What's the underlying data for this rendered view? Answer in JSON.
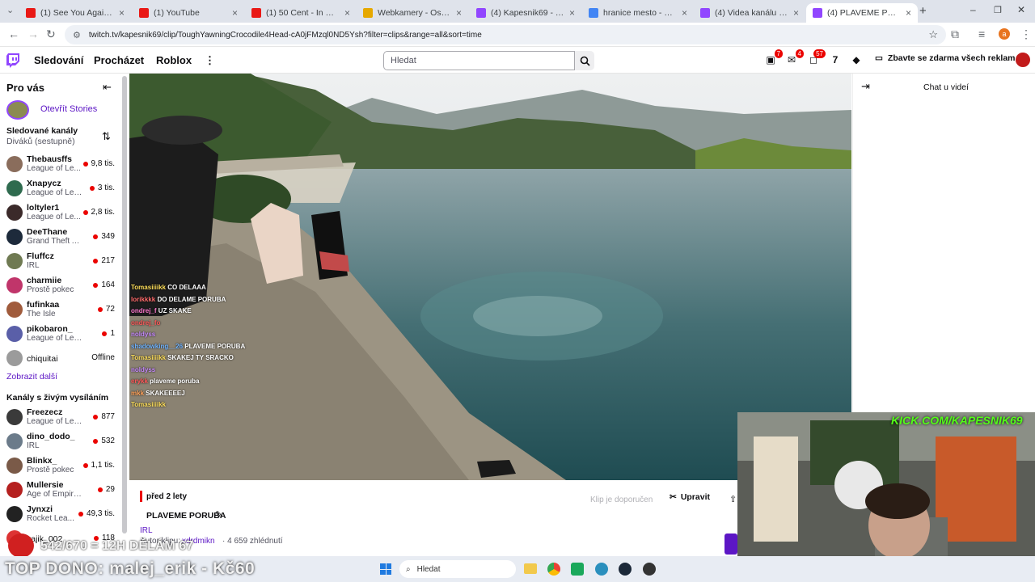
{
  "browser": {
    "tabs": [
      {
        "title": "(1) See You Again (Clean)",
        "color": "#e91916"
      },
      {
        "title": "(1) YouTube",
        "color": "#e91916"
      },
      {
        "title": "(1) 50 Cent - In Da Club (C",
        "color": "#e91916"
      },
      {
        "title": "Webkamery - Ostrava - V",
        "color": "#e6a800"
      },
      {
        "title": "(4) Kapesnik69 - Twitch",
        "color": "#9146ff"
      },
      {
        "title": "hranice mesto - Hledat G",
        "color": "#4285f4"
      },
      {
        "title": "(4) Videa kanálu Kapesni",
        "color": "#9146ff"
      },
      {
        "title": "(4) PLAVEME PORUBA",
        "color": "#9146ff"
      }
    ],
    "url": "twitch.tv/kapesnik69/clip/ToughYawningCrocodile4Head-cA0jFMzql0ND5Ysh?filter=clips&range=all&sort=time",
    "profile_letter": "a"
  },
  "header": {
    "nav": [
      "Sledování",
      "Procházet",
      "Roblox"
    ],
    "more": "⋮",
    "search_placeholder": "Hledat",
    "badges": {
      "prime": "7",
      "inbox": "4",
      "notifications": "57"
    },
    "promo": "Zbavte se zdarma všech reklam"
  },
  "sidebar": {
    "for_you": "Pro vás",
    "stories": "Otevřít Stories",
    "followed_title": "Sledované kanály",
    "followed_sort": "Diváků (sestupně)",
    "followed": [
      {
        "name": "Thebausffs",
        "game": "League of Le...",
        "viewers": "9,8 tis.",
        "color": "#8a6d5c"
      },
      {
        "name": "Xnapycz",
        "game": "League of Leg...",
        "viewers": "3 tis.",
        "color": "#2f6b4f"
      },
      {
        "name": "loltyler1",
        "game": "League of Le...",
        "viewers": "2,8 tis.",
        "color": "#3b2a2a"
      },
      {
        "name": "DeeThane",
        "game": "Grand Theft Au...",
        "viewers": "349",
        "color": "#1d2a3b"
      },
      {
        "name": "Fluffcz",
        "game": "IRL",
        "viewers": "217",
        "color": "#6f7a52"
      },
      {
        "name": "charmiie",
        "game": "Prostě pokec",
        "viewers": "164",
        "color": "#c0356a"
      },
      {
        "name": "fufinkaa",
        "game": "The Isle",
        "viewers": "72",
        "color": "#a05b3c"
      },
      {
        "name": "pikobaron_",
        "game": "League of Leg...",
        "viewers": "1",
        "color": "#5a5fa8"
      },
      {
        "name": "chiquitai",
        "game": "",
        "viewers": "Offline",
        "color": "#9b9b9b"
      }
    ],
    "show_more": "Zobrazit další",
    "live_title": "Kanály s živým vysíláním",
    "live": [
      {
        "name": "Freezecz",
        "game": "League of Lege...",
        "viewers": "877",
        "color": "#3a3a3a"
      },
      {
        "name": "dino_dodo_",
        "game": "IRL",
        "viewers": "532",
        "color": "#6b7b8a"
      },
      {
        "name": "Blinkx_",
        "game": "Prostě pokec",
        "viewers": "1,1 tis.",
        "color": "#7a5a48"
      },
      {
        "name": "Mullersie",
        "game": "Age of Empires II",
        "viewers": "29",
        "color": "#b5201f"
      },
      {
        "name": "Jynxzi",
        "game": "Rocket Lea...",
        "viewers": "49,3 tis.",
        "color": "#222"
      },
      {
        "name": "kajik_002",
        "game": "",
        "viewers": "118",
        "color": "#d33"
      }
    ]
  },
  "video": {
    "overlay_chat": [
      {
        "user": "Tomasiiiikk",
        "msg": "CO DELAAA",
        "color": "#ffdf5a"
      },
      {
        "user": "lorikkkk",
        "msg": "DO DELAME PORUBA",
        "color": "#ff6b6b"
      },
      {
        "user": "ondrej_f",
        "msg": "UZ SKAKE",
        "color": "#ff7ad0"
      },
      {
        "user": "ondrej_fo",
        "msg": "",
        "color": "#ff5a5a"
      },
      {
        "user": "noldyss",
        "msg": "",
        "color": "#c88bff"
      },
      {
        "user": "shadowking__26",
        "msg": "PLAVEME PORUBA",
        "color": "#6fb3ff"
      },
      {
        "user": "Tomasiiiikk",
        "msg": "SKAKEJ TY SRACKO",
        "color": "#ffdf5a"
      },
      {
        "user": "noldyss",
        "msg": "",
        "color": "#c88bff"
      },
      {
        "user": "erykk",
        "msg": "plaveme poruba",
        "color": "#ff5a5a"
      },
      {
        "user": "mkk",
        "msg": "SKAKEEEEJ",
        "color": "#ffa25a"
      },
      {
        "user": "Tomasiiiikk",
        "msg": "",
        "color": "#ffdf5a"
      }
    ]
  },
  "chat_panel": {
    "title": "Chat u videí"
  },
  "clip_info": {
    "age": "před 2 lety",
    "title": "PLAVEME PORUBA",
    "category": "IRL",
    "author_label": "Autor klipu:",
    "author": "xdrdmikn",
    "views": "· 4 659 zhlédnutí",
    "recommended": "Klip je doporučen",
    "edit": "Upravit"
  },
  "overlay": {
    "kick": "KICK.COM/KAPESNIK69",
    "goal": "542/670 = 12H DĚLÁM 67",
    "top_donor": "TOP DONO: malej_erik - Kč60"
  },
  "taskbar": {
    "search": "Hledat"
  }
}
